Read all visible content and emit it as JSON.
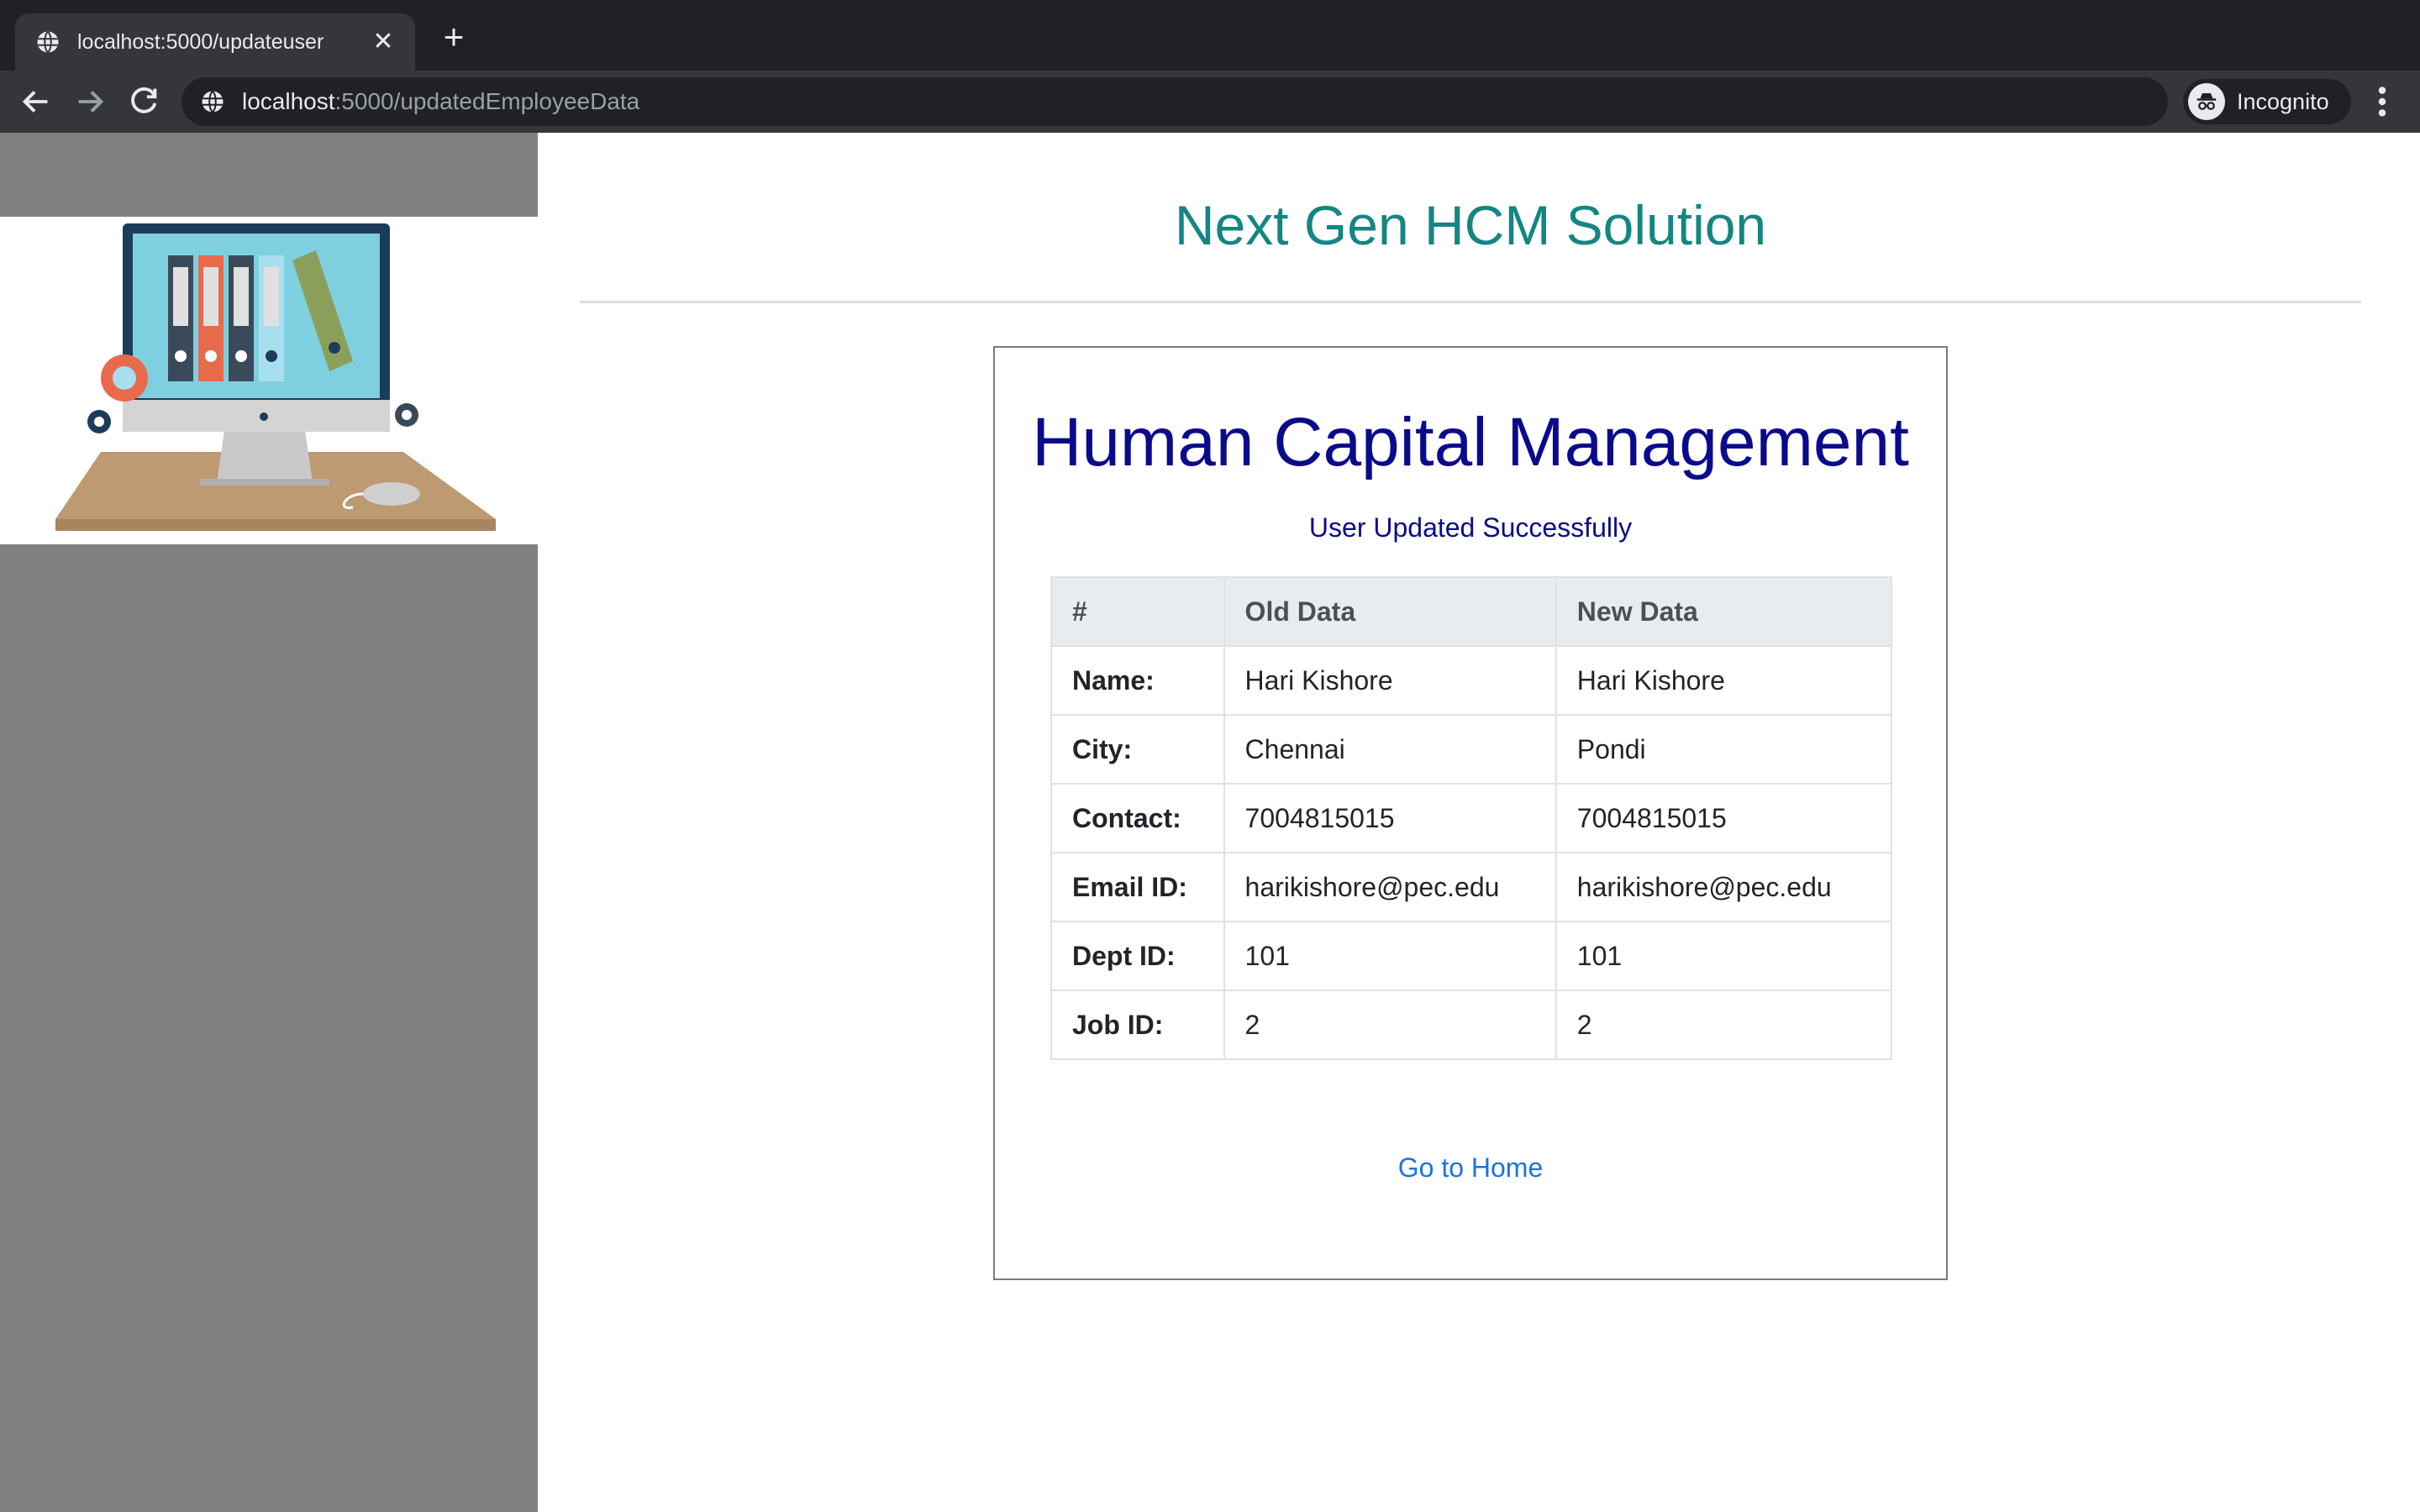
{
  "browser": {
    "tab_title": "localhost:5000/updateuser",
    "url_host": "localhost",
    "url_path": ":5000/updatedEmployeeData",
    "incognito_label": "Incognito"
  },
  "page": {
    "site_title": "Next Gen HCM Solution",
    "card_heading": "Human Capital Management",
    "status_message": "User Updated Successfully",
    "table": {
      "headers": [
        "#",
        "Old Data",
        "New Data"
      ],
      "rows": [
        {
          "label": "Name:",
          "old": "Hari Kishore",
          "new": "Hari Kishore"
        },
        {
          "label": "City:",
          "old": "Chennai",
          "new": "Pondi"
        },
        {
          "label": "Contact:",
          "old": "7004815015",
          "new": "7004815015"
        },
        {
          "label": "Email ID:",
          "old": "harikishore@pec.edu",
          "new": "harikishore@pec.edu"
        },
        {
          "label": "Dept ID:",
          "old": "101",
          "new": "101"
        },
        {
          "label": "Job ID:",
          "old": "2",
          "new": "2"
        }
      ]
    },
    "home_link": "Go to Home"
  },
  "colors": {
    "site_title": "#138682",
    "card_heading": "#0a0a8c",
    "link": "#1a73e8",
    "sidebar": "#808080"
  },
  "icons": [
    "globe-icon",
    "close-icon",
    "plus-icon",
    "back-arrow-icon",
    "forward-arrow-icon",
    "reload-icon",
    "site-info-icon",
    "incognito-icon",
    "more-vert-icon"
  ]
}
